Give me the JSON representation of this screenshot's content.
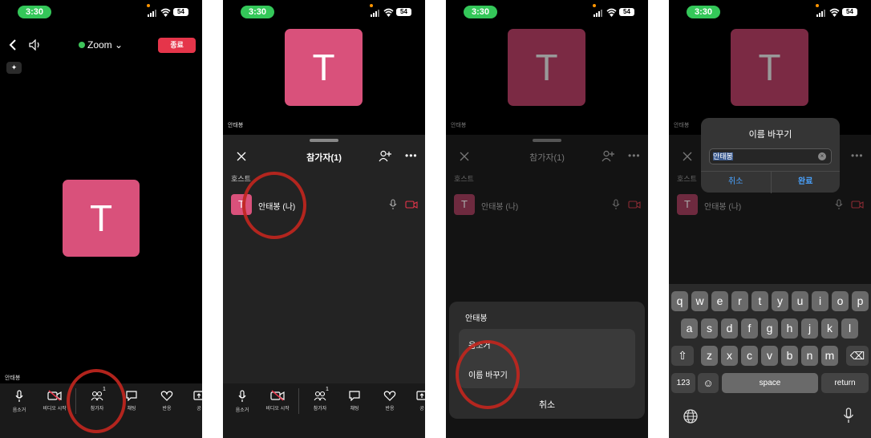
{
  "status": {
    "time": "3:30",
    "battery": "54"
  },
  "panel1": {
    "title": "Zoom",
    "end_label": "종료",
    "participant_label": "안태봉",
    "avatar_letter": "T",
    "toolbar": [
      {
        "icon": "mic-icon",
        "label": "음소거"
      },
      {
        "icon": "video-icon",
        "label": "비디오 시작"
      },
      {
        "icon": "participants-icon",
        "label": "참가자",
        "count": "1"
      },
      {
        "icon": "chat-icon",
        "label": "채팅"
      },
      {
        "icon": "heart-icon",
        "label": "반응"
      },
      {
        "icon": "share-icon",
        "label": "공"
      }
    ]
  },
  "panel2": {
    "avatar_letter": "T",
    "video_label": "안태봉",
    "sheet_title": "참가자(1)",
    "section": "호스트",
    "participant_initial": "T",
    "participant_name": "안태봉 (나)",
    "toolbar": [
      {
        "label": "음소거"
      },
      {
        "label": "비디오 시작"
      },
      {
        "label": "참가자",
        "count": "1"
      },
      {
        "label": "채팅"
      },
      {
        "label": "반응"
      },
      {
        "label": "공"
      }
    ]
  },
  "panel3": {
    "avatar_letter": "T",
    "video_label": "안태봉",
    "sheet_title": "참가자(1)",
    "section": "호스트",
    "participant_initial": "T",
    "participant_name": "안태봉 (나)",
    "action_title": "안태봉",
    "action_items": [
      "음소거",
      "이름 바꾸기"
    ],
    "cancel": "취소"
  },
  "panel4": {
    "avatar_letter": "T",
    "video_label": "안태봉",
    "section": "호스트",
    "participant_initial": "T",
    "participant_name": "안태봉 (나)",
    "dialog_title": "이름 바꾸기",
    "input_value": "안태봉",
    "cancel": "취소",
    "confirm": "완료",
    "keyboard": {
      "row1": [
        "q",
        "w",
        "e",
        "r",
        "t",
        "y",
        "u",
        "i",
        "o",
        "p"
      ],
      "row2": [
        "a",
        "s",
        "d",
        "f",
        "g",
        "h",
        "j",
        "k",
        "l"
      ],
      "row3": [
        "z",
        "x",
        "c",
        "v",
        "b",
        "n",
        "m"
      ],
      "num_key": "123",
      "space": "space",
      "return": "return"
    }
  },
  "colors": {
    "avatar": "#d9517b",
    "end_button": "#e5354a",
    "status_pill": "#34c759",
    "dialog_button": "#4aa3ff",
    "annotation_circle": "#c0261e"
  }
}
